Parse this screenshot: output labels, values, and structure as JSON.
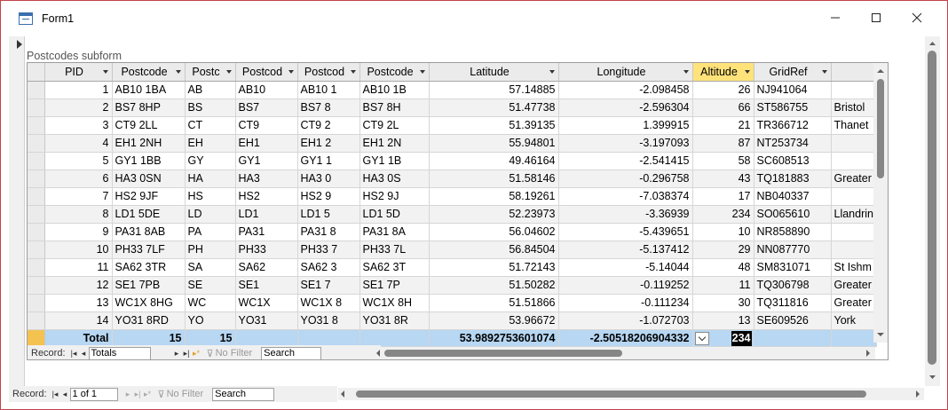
{
  "window": {
    "title": "Form1"
  },
  "subform": {
    "label": "Postcodes subform",
    "columns": [
      "PID",
      "Postcode",
      "Postc",
      "Postcod",
      "Postcod",
      "Postcode",
      "Latitude",
      "Longitude",
      "Altitude",
      "GridRef",
      ""
    ],
    "rows": [
      [
        "1",
        "AB10 1BA",
        "AB",
        "AB10",
        "AB10 1",
        "AB10 1B",
        "57.14885",
        "-2.098458",
        "26",
        "NJ941064",
        ""
      ],
      [
        "2",
        "BS7 8HP",
        "BS",
        "BS7",
        "BS7 8",
        "BS7 8H",
        "51.47738",
        "-2.596304",
        "66",
        "ST586755",
        "Bristol"
      ],
      [
        "3",
        "CT9 2LL",
        "CT",
        "CT9",
        "CT9 2",
        "CT9 2L",
        "51.39135",
        "1.399915",
        "21",
        "TR366712",
        "Thanet"
      ],
      [
        "4",
        "EH1 2NH",
        "EH",
        "EH1",
        "EH1 2",
        "EH1 2N",
        "55.94801",
        "-3.197093",
        "87",
        "NT253734",
        ""
      ],
      [
        "5",
        "GY1 1BB",
        "GY",
        "GY1",
        "GY1 1",
        "GY1 1B",
        "49.46164",
        "-2.541415",
        "58",
        "SC608513",
        ""
      ],
      [
        "6",
        "HA3 0SN",
        "HA",
        "HA3",
        "HA3 0",
        "HA3 0S",
        "51.58146",
        "-0.296758",
        "43",
        "TQ181883",
        "Greater"
      ],
      [
        "7",
        "HS2 9JF",
        "HS",
        "HS2",
        "HS2 9",
        "HS2 9J",
        "58.19261",
        "-7.038374",
        "17",
        "NB040337",
        ""
      ],
      [
        "8",
        "LD1 5DE",
        "LD",
        "LD1",
        "LD1 5",
        "LD1 5D",
        "52.23973",
        "-3.36939",
        "234",
        "SO065610",
        "Llandrin"
      ],
      [
        "9",
        "PA31 8AB",
        "PA",
        "PA31",
        "PA31 8",
        "PA31 8A",
        "56.04602",
        "-5.439651",
        "10",
        "NR858890",
        ""
      ],
      [
        "10",
        "PH33 7LF",
        "PH",
        "PH33",
        "PH33 7",
        "PH33 7L",
        "56.84504",
        "-5.137412",
        "29",
        "NN087770",
        ""
      ],
      [
        "11",
        "SA62 3TR",
        "SA",
        "SA62",
        "SA62 3",
        "SA62 3T",
        "51.72143",
        "-5.14044",
        "48",
        "SM831071",
        "St Ishm"
      ],
      [
        "12",
        "SE1 7PB",
        "SE",
        "SE1",
        "SE1 7",
        "SE1 7P",
        "51.50282",
        "-0.119252",
        "11",
        "TQ306798",
        "Greater"
      ],
      [
        "13",
        "WC1X 8HG",
        "WC",
        "WC1X",
        "WC1X 8",
        "WC1X 8H",
        "51.51866",
        "-0.111234",
        "30",
        "TQ311816",
        "Greater"
      ],
      [
        "14",
        "YO31 8RD",
        "YO",
        "YO31",
        "YO31 8",
        "YO31 8R",
        "53.96672",
        "-1.072703",
        "13",
        "SE609526",
        "York"
      ]
    ],
    "totals": {
      "label": "Total",
      "postcode": "15",
      "postc": "15",
      "latitude": "53.9892753601074",
      "longitude": "-2.50518206904332",
      "altitude": "234"
    },
    "nav": {
      "record_label": "Record:",
      "current": "Totals",
      "filter": "No Filter",
      "search": "Search"
    }
  },
  "main_nav": {
    "record_label": "Record:",
    "current": "1 of 1",
    "filter": "No Filter",
    "search": "Search"
  },
  "colors": {
    "accent_border": "#c3424a",
    "sorted_header": "#ffe27a",
    "totals_row": "#b7d7f3"
  }
}
